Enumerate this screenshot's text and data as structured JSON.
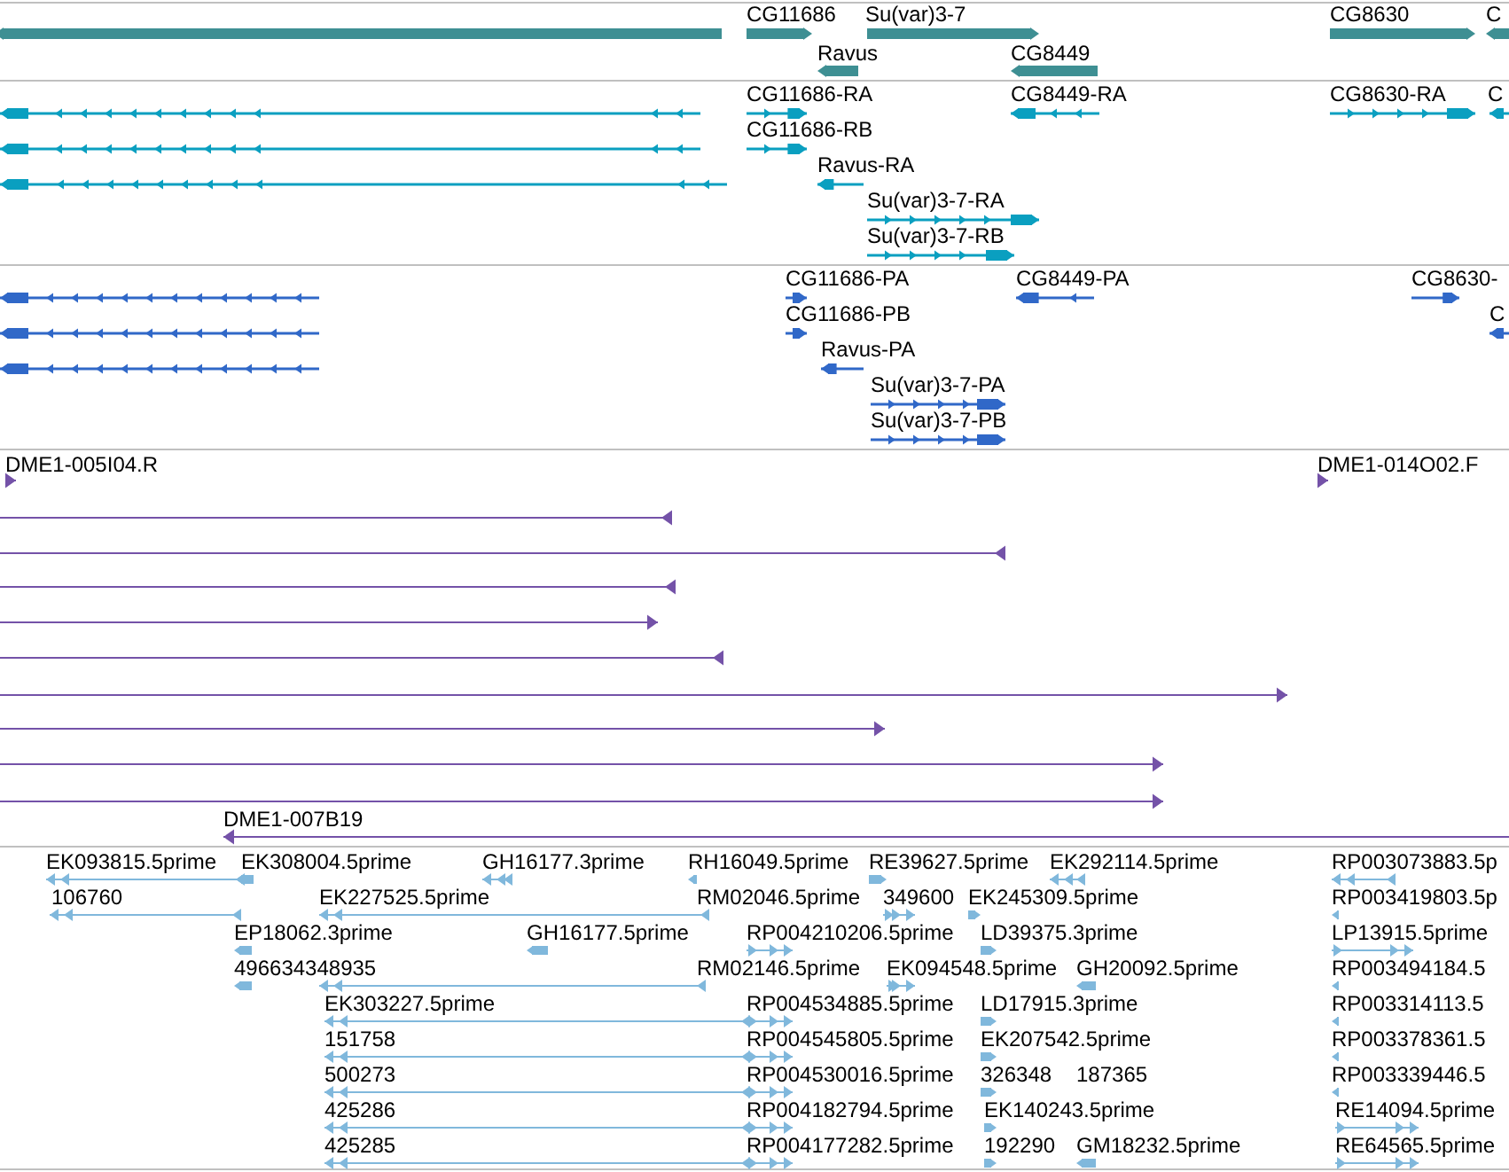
{
  "tracks": [
    {
      "kind": "gene",
      "features": [
        {
          "reverse": true
        },
        {
          "label": "CG11686",
          "reverse": false
        },
        {
          "label": "Su(var)3-7",
          "reverse": false
        },
        {
          "label": "Ravus",
          "reverse": true
        },
        {
          "label": "CG8449",
          "reverse": true
        },
        {
          "label": "CG8630",
          "reverse": false
        },
        {
          "label": "C",
          "reverse": true
        }
      ]
    },
    {
      "kind": "transcript",
      "features": [
        {
          "reverse": true
        },
        {
          "reverse": true
        },
        {
          "reverse": true
        },
        {
          "label": "CG11686-RA",
          "reverse": false
        },
        {
          "label": "CG11686-RB",
          "reverse": false
        },
        {
          "label": "Ravus-RA",
          "reverse": true
        },
        {
          "label": "Su(var)3-7-RA",
          "reverse": false
        },
        {
          "label": "Su(var)3-7-RB",
          "reverse": false
        },
        {
          "label": "CG8449-RA",
          "reverse": true
        },
        {
          "label": "CG8630-RA",
          "reverse": false
        },
        {
          "label": "C",
          "reverse": true
        }
      ]
    },
    {
      "kind": "protein",
      "features": [
        {
          "reverse": true
        },
        {
          "reverse": true
        },
        {
          "reverse": true
        },
        {
          "label": "CG11686-PA",
          "reverse": false
        },
        {
          "label": "CG11686-PB",
          "reverse": false
        },
        {
          "label": "Ravus-PA",
          "reverse": true
        },
        {
          "label": "Su(var)3-7-PA",
          "reverse": false
        },
        {
          "label": "Su(var)3-7-PB",
          "reverse": false
        },
        {
          "label": "CG8449-PA",
          "reverse": true
        },
        {
          "label": "CG8630-",
          "reverse": false
        },
        {
          "label": "C",
          "reverse": true
        }
      ]
    },
    {
      "kind": "clone",
      "features": [
        {
          "label": "DME1-005I04.R",
          "reverse": false
        },
        {
          "reverse": true
        },
        {
          "reverse": true
        },
        {
          "reverse": true
        },
        {
          "reverse": false
        },
        {
          "reverse": true
        },
        {
          "reverse": false
        },
        {
          "reverse": false
        },
        {
          "reverse": false
        },
        {
          "reverse": false
        },
        {
          "label": "DME1-014O02.F",
          "reverse": false
        },
        {
          "label": "DME1-007B19",
          "reverse": true
        }
      ]
    },
    {
      "kind": "est",
      "features": [
        {
          "label": "EK093815.5prime",
          "reverse": true
        },
        {
          "label": "EK308004.5prime",
          "reverse": true
        },
        {
          "label": "GH16177.3prime",
          "reverse": true
        },
        {
          "label": "RH16049.5prime",
          "reverse": true
        },
        {
          "label": "RE39627.5prime",
          "reverse": false
        },
        {
          "label": "EK292114.5prime",
          "reverse": true
        },
        {
          "label": "RP003073883.5p",
          "reverse": true
        },
        {
          "label": "106760",
          "reverse": true
        },
        {
          "label": "EK227525.5prime",
          "reverse": true
        },
        {
          "label": "RM02046.5prime"
        },
        {
          "label": "349600",
          "reverse": false
        },
        {
          "label": "EK245309.5prime",
          "reverse": false
        },
        {
          "label": "RP003419803.5p",
          "reverse": true
        },
        {
          "label": "EP18062.3prime",
          "reverse": true
        },
        {
          "label": "GH16177.5prime",
          "reverse": true
        },
        {
          "label": "RP004210206.5prime",
          "reverse": false
        },
        {
          "label": "LD39375.3prime",
          "reverse": false
        },
        {
          "label": "LP13915.5prime",
          "reverse": false
        },
        {
          "label": "496634348935",
          "reverse": true
        },
        {
          "label": "RM02146.5prime",
          "reverse": true
        },
        {
          "label": "EK094548.5prime",
          "reverse": false
        },
        {
          "label": "GH20092.5prime",
          "reverse": true
        },
        {
          "label": "RP003494184.5",
          "reverse": true
        },
        {
          "label": "EK303227.5prime",
          "reverse": true
        },
        {
          "label": "RP004534885.5prime",
          "reverse": false
        },
        {
          "label": "LD17915.3prime",
          "reverse": false
        },
        {
          "label": "RP003314113.5",
          "reverse": true
        },
        {
          "label": "151758",
          "reverse": true
        },
        {
          "label": "RP004545805.5prime",
          "reverse": false
        },
        {
          "label": "EK207542.5prime",
          "reverse": false
        },
        {
          "label": "RP003378361.5",
          "reverse": true
        },
        {
          "label": "500273",
          "reverse": true
        },
        {
          "label": "RP004530016.5prime",
          "reverse": false
        },
        {
          "label": "326348",
          "reverse": false
        },
        {
          "label": "187365"
        },
        {
          "label": "RP003339446.5",
          "reverse": true
        },
        {
          "label": "425286",
          "reverse": true
        },
        {
          "label": "RP004182794.5prime",
          "reverse": false
        },
        {
          "label": "EK140243.5prime",
          "reverse": false
        },
        {
          "label": "RE14094.5prime",
          "reverse": false
        },
        {
          "label": "425285",
          "reverse": true
        },
        {
          "label": "RP004177282.5prime",
          "reverse": false
        },
        {
          "label": "192290",
          "reverse": false
        },
        {
          "label": "GM18232.5prime",
          "reverse": true
        },
        {
          "label": "RE64565.5prime",
          "reverse": false
        }
      ]
    }
  ]
}
